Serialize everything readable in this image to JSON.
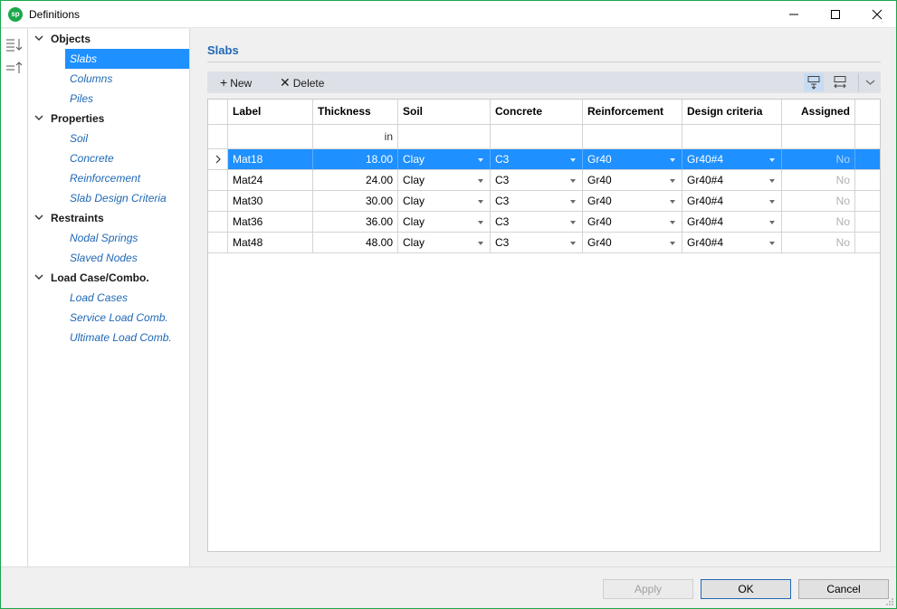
{
  "window": {
    "title": "Definitions",
    "logo": "sp"
  },
  "tree": [
    {
      "label": "Objects",
      "items": [
        {
          "label": "Slabs",
          "selected": true
        },
        {
          "label": "Columns"
        },
        {
          "label": "Piles"
        }
      ]
    },
    {
      "label": "Properties",
      "items": [
        {
          "label": "Soil"
        },
        {
          "label": "Concrete"
        },
        {
          "label": "Reinforcement"
        },
        {
          "label": "Slab Design Criteria"
        }
      ]
    },
    {
      "label": "Restraints",
      "items": [
        {
          "label": "Nodal Springs"
        },
        {
          "label": "Slaved Nodes"
        }
      ]
    },
    {
      "label": "Load Case/Combo.",
      "items": [
        {
          "label": "Load Cases"
        },
        {
          "label": "Service Load Comb."
        },
        {
          "label": "Ultimate Load Comb."
        }
      ]
    }
  ],
  "panel": {
    "title": "Slabs"
  },
  "toolbar": {
    "new_label": "New",
    "delete_label": "Delete"
  },
  "grid": {
    "columns": [
      "Label",
      "Thickness",
      "Soil",
      "Concrete",
      "Reinforcement",
      "Design criteria",
      "Assigned"
    ],
    "units": [
      "",
      "in",
      "",
      "",
      "",
      "",
      ""
    ],
    "rows": [
      {
        "label": "Mat18",
        "thickness": "18.00",
        "soil": "Clay",
        "concrete": "C3",
        "reinforcement": "Gr40",
        "design": "Gr40#4",
        "assigned": "No",
        "selected": true
      },
      {
        "label": "Mat24",
        "thickness": "24.00",
        "soil": "Clay",
        "concrete": "C3",
        "reinforcement": "Gr40",
        "design": "Gr40#4",
        "assigned": "No"
      },
      {
        "label": "Mat30",
        "thickness": "30.00",
        "soil": "Clay",
        "concrete": "C3",
        "reinforcement": "Gr40",
        "design": "Gr40#4",
        "assigned": "No"
      },
      {
        "label": "Mat36",
        "thickness": "36.00",
        "soil": "Clay",
        "concrete": "C3",
        "reinforcement": "Gr40",
        "design": "Gr40#4",
        "assigned": "No"
      },
      {
        "label": "Mat48",
        "thickness": "48.00",
        "soil": "Clay",
        "concrete": "C3",
        "reinforcement": "Gr40",
        "design": "Gr40#4",
        "assigned": "No"
      }
    ]
  },
  "footer": {
    "apply_label": "Apply",
    "ok_label": "OK",
    "cancel_label": "Cancel"
  },
  "colors": {
    "accent": "#1e90ff",
    "link": "#1f68b5",
    "brand": "#1aa84a"
  },
  "icons": [
    "expand-all-icon",
    "collapse-all-icon",
    "plus-icon",
    "x-icon",
    "insert-row-above-icon",
    "insert-row-below-icon",
    "chevron-down-icon",
    "minimize-icon",
    "maximize-icon",
    "close-icon",
    "row-pointer-icon"
  ]
}
